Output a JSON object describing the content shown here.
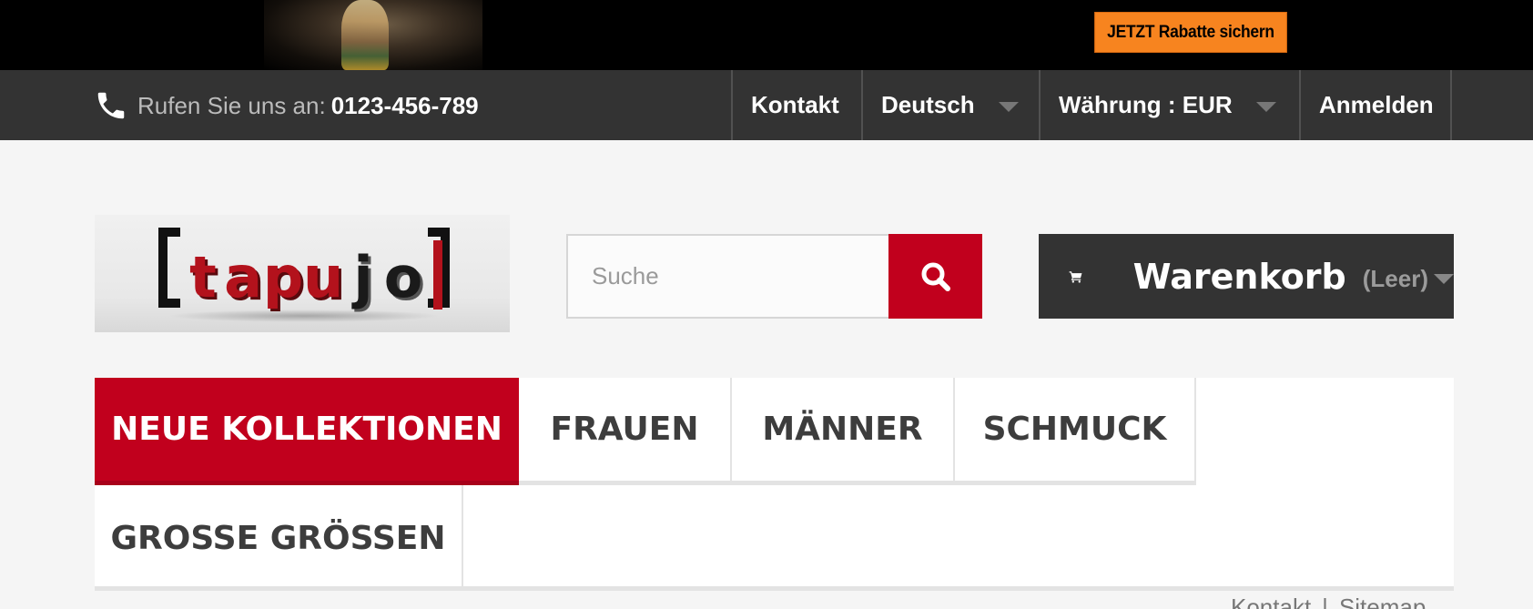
{
  "banner": {
    "cta_label": "JETZT Rabatte sichern"
  },
  "topnav": {
    "phone_label": "Rufen Sie uns an:",
    "phone_number": "0123-456-789",
    "contact_label": "Kontakt",
    "language_label": "Deutsch",
    "currency_label": "Währung : EUR",
    "login_label": "Anmelden"
  },
  "header": {
    "logo_text": "tapujo",
    "search_placeholder": "Suche",
    "cart_label": "Warenkorb",
    "cart_status": "(Leer)"
  },
  "menu": {
    "items": [
      {
        "label": "NEUE KOLLEKTIONEN"
      },
      {
        "label": "FRAUEN"
      },
      {
        "label": "MÄNNER"
      },
      {
        "label": "SCHMUCK"
      },
      {
        "label": "GROSSE GRÖSSEN"
      }
    ]
  },
  "footer": {
    "contact_label": "Kontakt",
    "separator": "|",
    "sitemap_label": "Sitemap"
  },
  "colors": {
    "accent_red": "#c1001d",
    "dark_bar": "#333333",
    "cta_orange": "#f7841f"
  },
  "icons": [
    "phone-icon",
    "search-icon",
    "cart-icon",
    "chevron-down-icon"
  ]
}
